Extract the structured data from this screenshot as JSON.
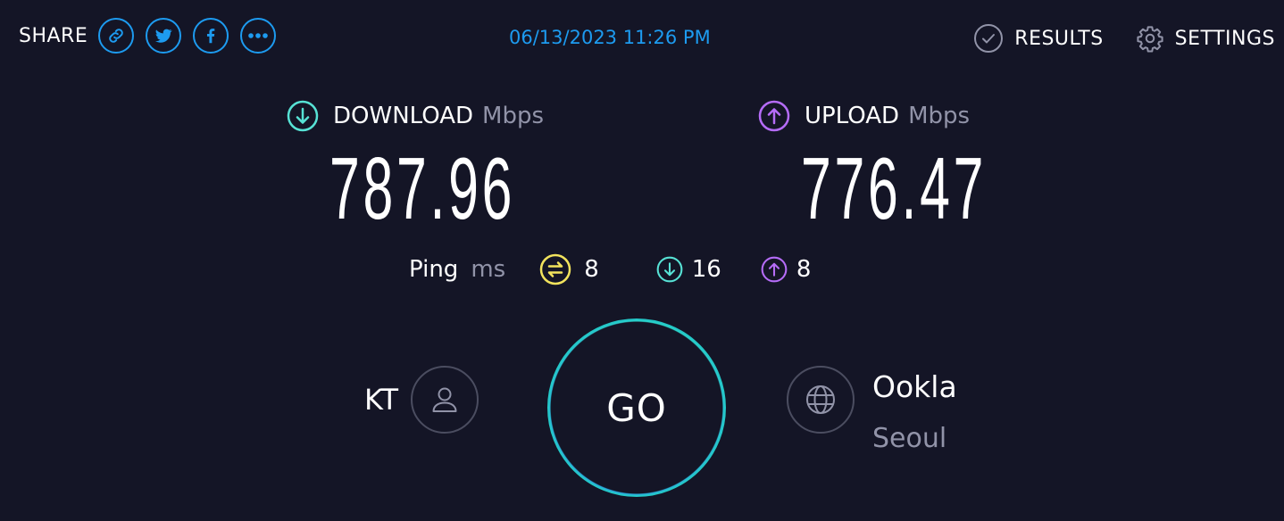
{
  "share": {
    "label": "SHARE",
    "buttons": [
      {
        "icon": "link-icon"
      },
      {
        "icon": "twitter-icon"
      },
      {
        "icon": "facebook-icon"
      },
      {
        "icon": "more-icon"
      }
    ]
  },
  "timestamp": "06/13/2023 11:26 PM",
  "top_links": {
    "results_label": "RESULTS",
    "settings_label": "SETTINGS"
  },
  "download": {
    "title": "DOWNLOAD",
    "unit": "Mbps",
    "value": "787.96",
    "icon": "download-arrow-icon",
    "color": "#57e2d5"
  },
  "upload": {
    "title": "UPLOAD",
    "unit": "Mbps",
    "value": "776.47",
    "icon": "upload-arrow-icon",
    "color": "#b56cf7"
  },
  "ping": {
    "label": "Ping",
    "unit": "ms",
    "idle": {
      "value": "8",
      "icon": "ping-idle-icon",
      "color": "#f2e35d"
    },
    "download": {
      "value": "16",
      "icon": "download-arrow-icon",
      "color": "#57e2d5"
    },
    "upload": {
      "value": "8",
      "icon": "upload-arrow-icon",
      "color": "#b56cf7"
    }
  },
  "provider": {
    "name": "KT",
    "icon": "user-icon"
  },
  "go_button": {
    "label": "GO"
  },
  "server": {
    "name": "Ookla",
    "location": "Seoul",
    "icon": "globe-icon"
  },
  "colors": {
    "background": "#141526",
    "accent_blue": "#1d9bf0",
    "muted_text": "#9193a8"
  }
}
